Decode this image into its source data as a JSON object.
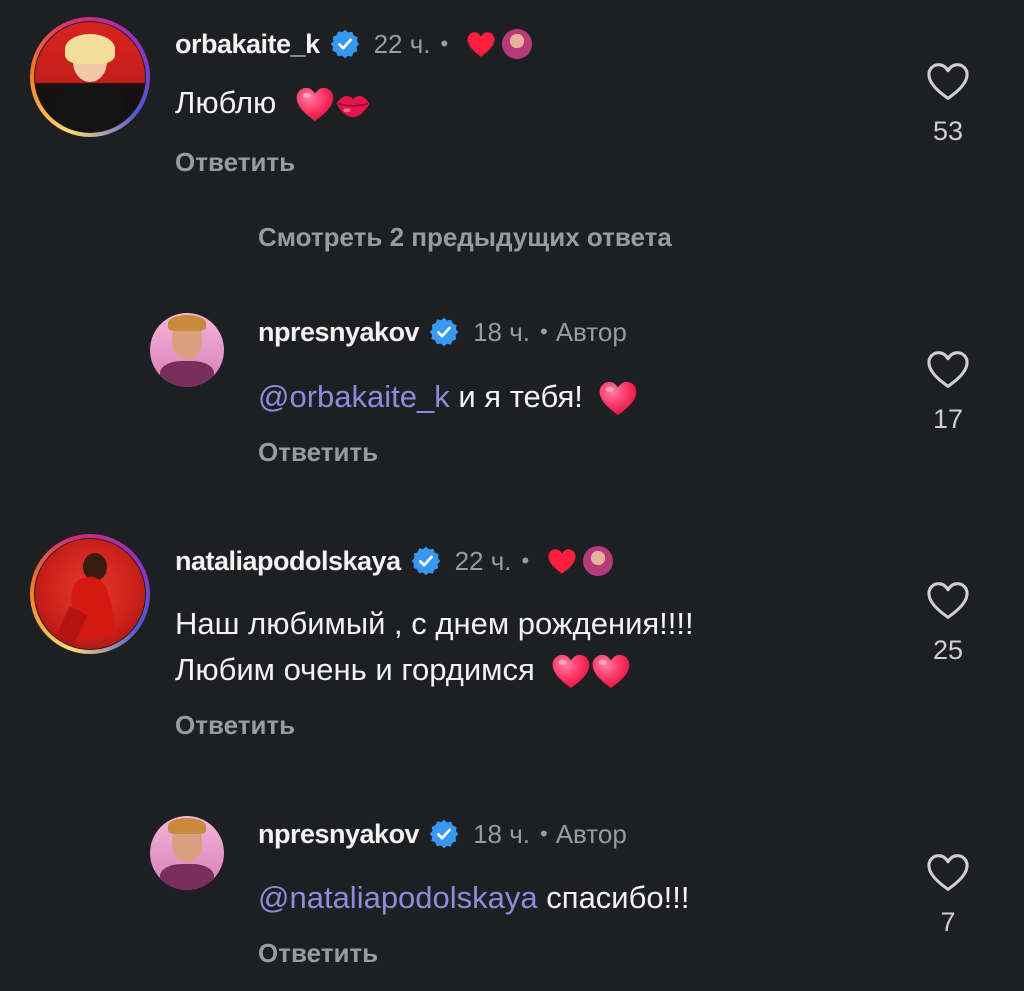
{
  "comments": [
    {
      "username": "orbakaite_k",
      "time": "22 ч.",
      "separator": "•",
      "text": "Люблю",
      "reply_label": "Ответить",
      "likes": "53"
    },
    {
      "username": "npresnyakov",
      "time": "18 ч.",
      "separator": "•",
      "author_label": "Автор",
      "mention": "@orbakaite_k",
      "text": "и я тебя!",
      "reply_label": "Ответить",
      "likes": "17"
    },
    {
      "username": "nataliapodolskaya",
      "time": "22 ч.",
      "separator": "•",
      "text_line1": "Наш любимый , с днем рождения!!!!",
      "text_line2": "Любим очень и гордимся",
      "reply_label": "Ответить",
      "likes": "25"
    },
    {
      "username": "npresnyakov",
      "time": "18 ч.",
      "separator": "•",
      "author_label": "Автор",
      "mention": "@nataliapodolskaya",
      "text": "спасибо!!!",
      "reply_label": "Ответить",
      "likes": "7"
    }
  ],
  "view_more": "Смотреть 2 предыдущих ответа",
  "colors": {
    "background": "#1e1f22",
    "mention": "#8f8bdc",
    "heart": "#ff2d55",
    "verified": "#3897f0",
    "muted": "#9a9b9f"
  },
  "icons": [
    "verified-badge-icon",
    "heart-outline-icon",
    "heart-filled-icon",
    "lips-icon"
  ]
}
